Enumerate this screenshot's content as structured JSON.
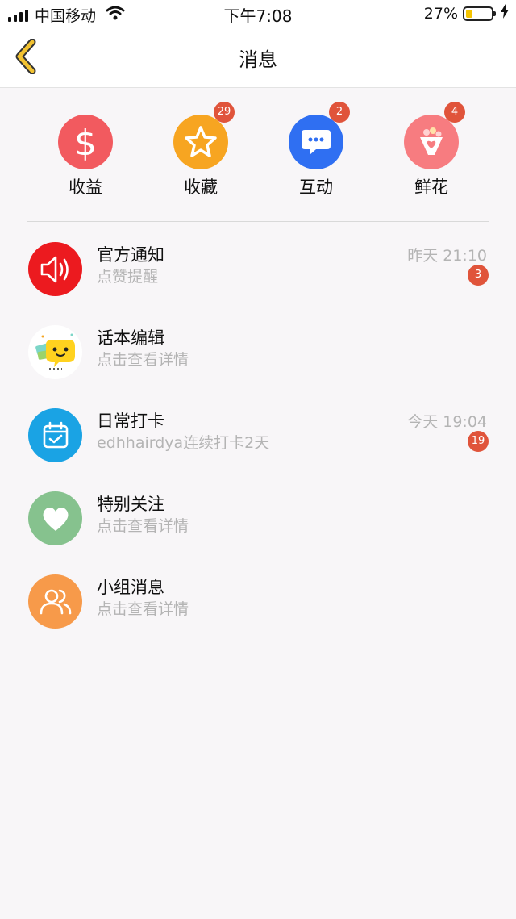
{
  "status_bar": {
    "carrier": "中国移动",
    "time": "下午7:08",
    "battery_percent": "27%",
    "battery_level": 0.27,
    "signal_icon": "signal-bars-icon",
    "wifi_icon": "wifi-icon",
    "battery_icon": "battery-icon",
    "charging_icon": "bolt-icon"
  },
  "nav": {
    "title": "消息",
    "back_icon": "chevron-left-icon",
    "back_color": "#f2c230"
  },
  "quick_actions": [
    {
      "label": "收益",
      "icon": "dollar-icon",
      "color": "#f25a5f",
      "badge": ""
    },
    {
      "label": "收藏",
      "icon": "star-icon",
      "color": "#f7a521",
      "badge": "29"
    },
    {
      "label": "互动",
      "icon": "chat-bubble-icon",
      "color": "#2f6ff2",
      "badge": "2"
    },
    {
      "label": "鲜花",
      "icon": "flower-bouquet-icon",
      "color": "#f77c80",
      "badge": "4"
    }
  ],
  "messages": [
    {
      "title": "官方通知",
      "subtitle": "点赞提醒",
      "time": "昨天 21:10",
      "badge": "3",
      "icon": "speaker-icon",
      "color": "#ec1a1f"
    },
    {
      "title": "话本编辑",
      "subtitle": "点击查看详情",
      "time": "",
      "badge": "",
      "icon": "editor-avatar-icon",
      "color": "#ffffff"
    },
    {
      "title": "日常打卡",
      "subtitle": "edhhairdya连续打卡2天",
      "time": "今天 19:04",
      "badge": "19",
      "icon": "calendar-check-icon",
      "color": "#1aa3e4"
    },
    {
      "title": "特别关注",
      "subtitle": "点击查看详情",
      "time": "",
      "badge": "",
      "icon": "heart-icon",
      "color": "#86c28e"
    },
    {
      "title": "小组消息",
      "subtitle": "点击查看详情",
      "time": "",
      "badge": "",
      "icon": "group-users-icon",
      "color": "#f79a4a"
    }
  ]
}
